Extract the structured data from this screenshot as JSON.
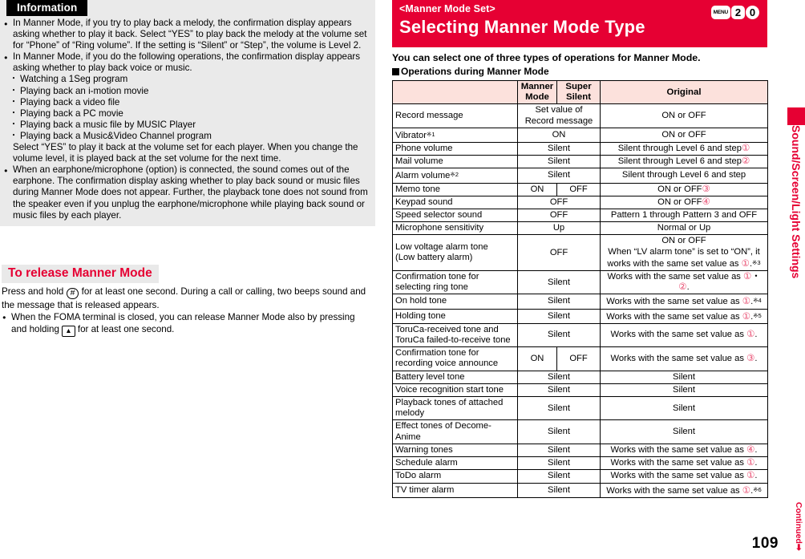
{
  "left": {
    "info_title": "Information",
    "bullets": [
      "In Manner Mode, if you try to play back a melody, the confirmation display appears asking whether to play it back. Select “YES” to play back the melody at the volume set for “Phone” of “Ring volume”. If the setting is “Silent” or “Step”, the volume is Level 2.",
      "In Manner Mode, if you do the following operations, the confirmation display appears asking whether to play back voice or music."
    ],
    "sub_items": [
      "Watching a 1Seg program",
      "Playing back an i-motion movie",
      "Playing back a video file",
      "Playing back a PC movie",
      "Playing back a music file by MUSIC Player",
      "Playing back a Music&Video Channel program"
    ],
    "after_sub": "Select “YES” to play it back at the volume set for each player. When you change the volume level, it is played back at the set volume for the next time.",
    "bullet3": "When an earphone/microphone (option) is connected, the sound comes out of the earphone. The confirmation display asking whether to play back sound or music files during Manner Mode does not appear. Further, the playback tone does not sound from the speaker even if you unplug the earphone/microphone while playing back sound or music files by each player.",
    "release_heading": "To release Manner Mode",
    "release_p1a": "Press and hold",
    "release_key1": "#",
    "release_p1b": "for at least one second. During a call or calling, two beeps sound and the message that is released appears.",
    "release_p2a": "When the FOMA terminal is closed, you can release Manner Mode also by pressing and holding",
    "release_key2": "▲",
    "release_p2b": "for at least one second."
  },
  "header": {
    "sub_title": "<Manner Mode Set>",
    "title": "Selecting Manner Mode Type",
    "keys": [
      "MENU",
      "2",
      "0"
    ],
    "accent_color": "#e60033"
  },
  "intro": {
    "line": "You can select one of three types of operations for Manner Mode.",
    "section": "Operations during Manner Mode"
  },
  "table": {
    "headers": [
      "",
      "Manner Mode",
      "Super Silent",
      "Original"
    ],
    "rows": [
      {
        "label": "Record message",
        "merged_ms": true,
        "ms": "Set value of Record message",
        "orig": "ON or OFF"
      },
      {
        "label": "Vibrator※1",
        "merged_ms": true,
        "ms": "ON",
        "orig": "ON or OFF"
      },
      {
        "label": "Phone volume",
        "merged_ms": true,
        "ms": "Silent",
        "orig": "Silent through Level 6 and step①"
      },
      {
        "label": "Mail volume",
        "merged_ms": true,
        "ms": "Silent",
        "orig": "Silent through Level 6 and step②"
      },
      {
        "label": "Alarm volume※2",
        "merged_ms": true,
        "ms": "Silent",
        "orig": "Silent through Level 6 and step"
      },
      {
        "label": "Memo tone",
        "merged_ms": false,
        "manner": "ON",
        "super": "OFF",
        "orig": "ON or OFF③"
      },
      {
        "label": "Keypad sound",
        "merged_ms": true,
        "ms": "OFF",
        "orig": "ON or OFF④"
      },
      {
        "label": "Speed selector sound",
        "merged_ms": true,
        "ms": "OFF",
        "orig": "Pattern 1 through Pattern 3 and OFF"
      },
      {
        "label": "Microphone sensitivity",
        "merged_ms": true,
        "ms": "Up",
        "orig": "Normal or Up"
      },
      {
        "label": "Low voltage alarm tone\n(Low battery alarm)",
        "merged_ms": true,
        "ms": "OFF",
        "orig": "ON or OFF\nWhen “LV alarm tone” is set to “ON”, it works with the same set value as ①.※3"
      },
      {
        "label": "Confirmation tone for selecting ring tone",
        "merged_ms": true,
        "ms": "Silent",
        "orig": "Works with the same set value as ①・②."
      },
      {
        "label": "On hold tone",
        "merged_ms": true,
        "ms": "Silent",
        "orig": "Works with the same set value as ①.※4"
      },
      {
        "label": "Holding tone",
        "merged_ms": true,
        "ms": "Silent",
        "orig": "Works with the same set value as ①.※5"
      },
      {
        "label": "ToruCa-received tone and ToruCa failed-to-receive tone",
        "merged_ms": true,
        "ms": "Silent",
        "orig": "Works with the same set value as ①."
      },
      {
        "label": "Confirmation tone for recording voice announce",
        "merged_ms": false,
        "manner": "ON",
        "super": "OFF",
        "orig": "Works with the same set value as ③."
      },
      {
        "label": "Battery level tone",
        "merged_ms": true,
        "ms": "Silent",
        "orig": "Silent"
      },
      {
        "label": "Voice recognition start tone",
        "merged_ms": true,
        "ms": "Silent",
        "orig": "Silent"
      },
      {
        "label": "Playback tones of attached melody",
        "merged_ms": true,
        "ms": "Silent",
        "orig": "Silent"
      },
      {
        "label": "Effect tones of Decome-Anime",
        "merged_ms": true,
        "ms": "Silent",
        "orig": "Silent"
      },
      {
        "label": "Warning tones",
        "merged_ms": true,
        "ms": "Silent",
        "orig": "Works with the same set value as ④."
      },
      {
        "label": "Schedule alarm",
        "merged_ms": true,
        "ms": "Silent",
        "orig": "Works with the same set value as ①."
      },
      {
        "label": "ToDo alarm",
        "merged_ms": true,
        "ms": "Silent",
        "orig": "Works with the same set value as ①."
      },
      {
        "label": "TV timer alarm",
        "merged_ms": true,
        "ms": "Silent",
        "orig": "Works with the same set value as ①.※6"
      }
    ]
  },
  "side_tab": {
    "label": "Sound/Screen/Light Settings",
    "continued": "Continued➡"
  },
  "page_number": "109"
}
